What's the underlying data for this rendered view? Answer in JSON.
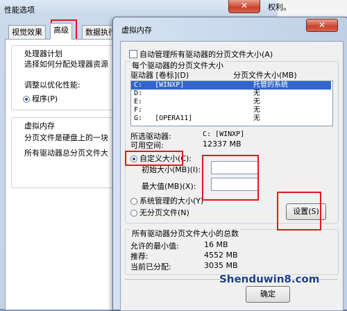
{
  "back_window": {
    "title": "性能选项",
    "close_glyph": "✕",
    "tabs": [
      "视觉效果",
      "高级",
      "数据执行"
    ],
    "processor": {
      "heading": "处理器计划",
      "desc": "选择如何分配处理器资源",
      "adjust_label": "调整以优化性能:",
      "program_option": "程序(P)"
    },
    "virtual_memory": {
      "heading": "虚拟内存",
      "desc1": "分页文件是硬盘上的一块",
      "desc2": "所有驱动器总分页文件大"
    }
  },
  "right_strip": {
    "text": "权利。"
  },
  "vm_dialog": {
    "title": "虚拟内存",
    "close_glyph": "✕",
    "auto_manage_label": "自动管理所有驱动器的分页文件大小(A)",
    "per_drive_heading": "每个驱动器的分页文件大小",
    "col_drive": "驱动器 [卷标](D)",
    "col_size": "分页文件大小(MB)",
    "drives": [
      {
        "drive": "C:   [WINXP]",
        "size": "托管的系统",
        "selected": true
      },
      {
        "drive": "D:",
        "size": "无",
        "selected": false
      },
      {
        "drive": "E:",
        "size": "无",
        "selected": false
      },
      {
        "drive": "F:",
        "size": "无",
        "selected": false
      },
      {
        "drive": "G:   [OPERA11]",
        "size": "无",
        "selected": false
      }
    ],
    "selected_drive_label": "所选驱动器:",
    "selected_drive_value": "C:  [WINXP]",
    "free_space_label": "可用空间:",
    "free_space_value": "12337 MB",
    "custom_size_label": "自定义大小(C):",
    "initial_size_label": "初始大小(MB)(I):",
    "initial_size_value": "",
    "max_size_label": "最大值(MB)(X):",
    "max_size_value": "",
    "system_managed_label": "系统管理的大小(Y)",
    "no_paging_label": "无分页文件(N)",
    "set_button": "设置(S)",
    "total_heading": "所有驱动器分页文件大小的总数",
    "min_allowed_label": "允许的最小值:",
    "min_allowed_value": "16 MB",
    "recommended_label": "推荐:",
    "recommended_value": "4552 MB",
    "current_label": "当前已分配:",
    "current_value": "3035 MB",
    "ok_button": "确定"
  },
  "watermark": {
    "text": "Shenduwin8.com"
  },
  "colors": {
    "highlight_red": "#e0191b",
    "selection_blue": "#3366cc"
  }
}
